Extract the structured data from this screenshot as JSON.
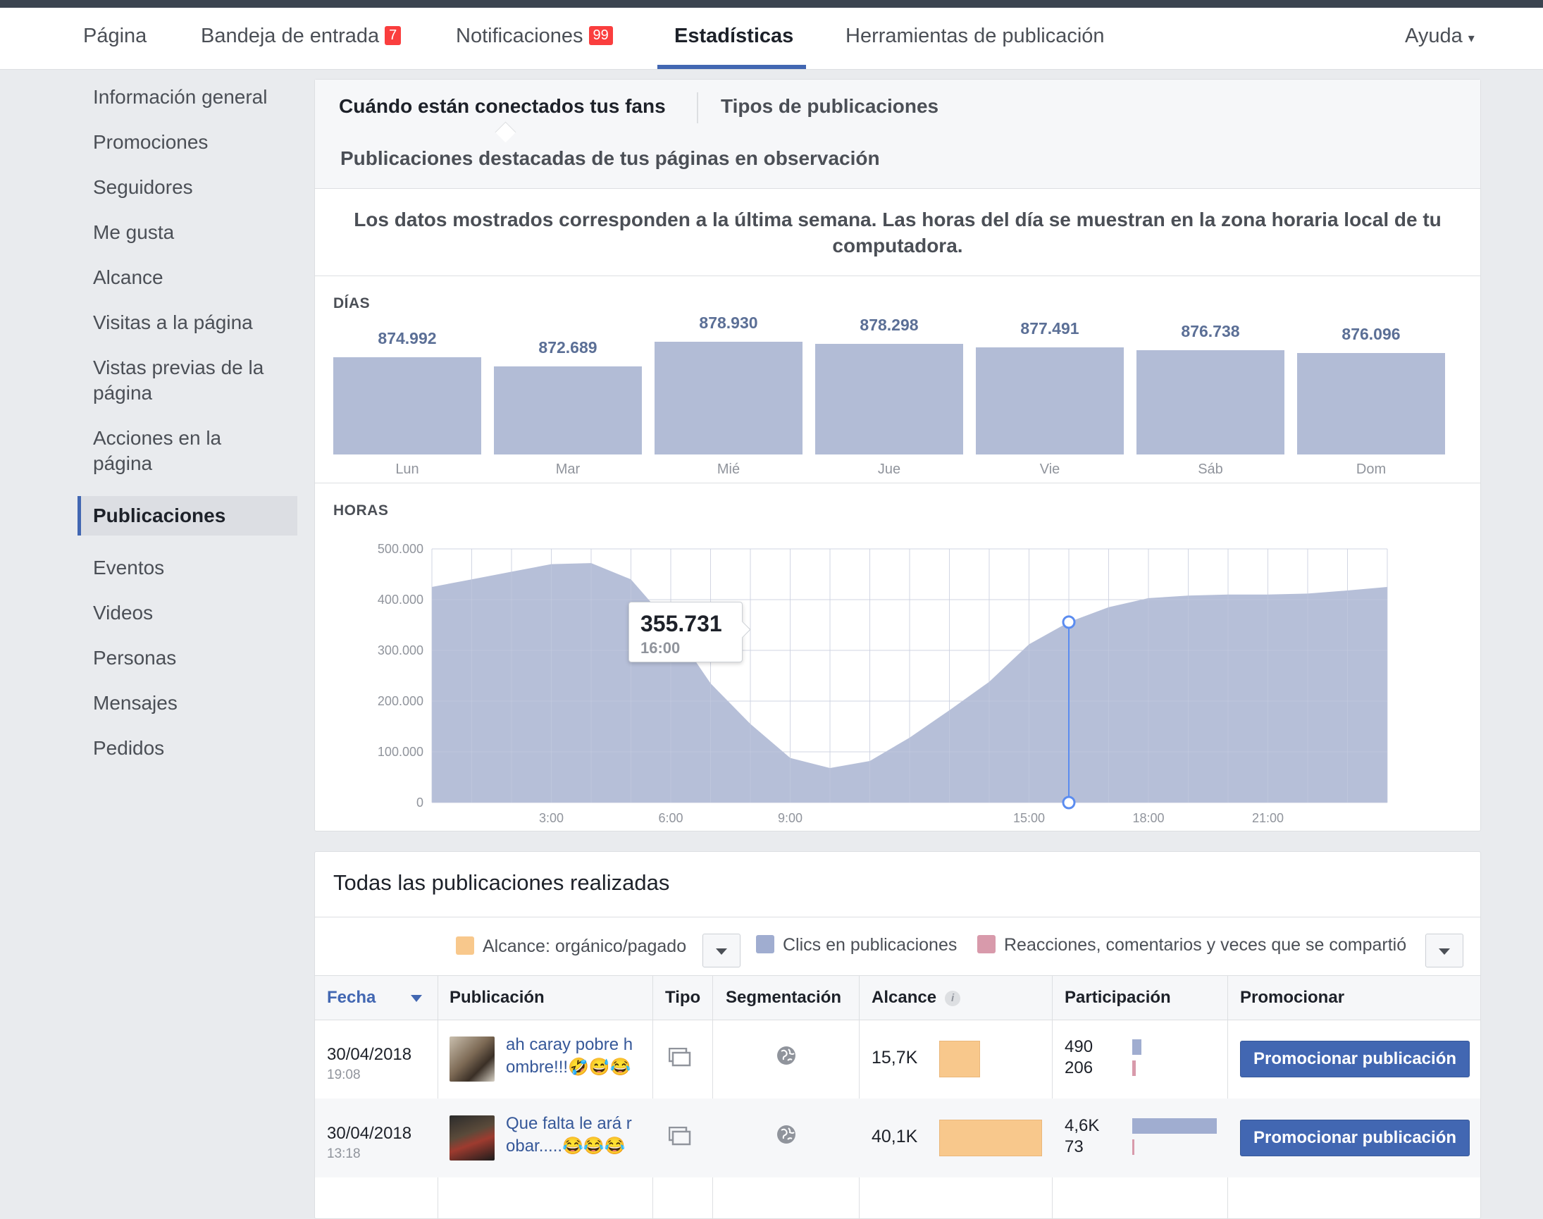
{
  "topnav": {
    "items": [
      {
        "label": "Página"
      },
      {
        "label": "Bandeja de entrada",
        "badge": "7"
      },
      {
        "label": "Notificaciones",
        "badge": "99"
      },
      {
        "label": "Estadísticas"
      },
      {
        "label": "Herramientas de publicación"
      }
    ],
    "help": "Ayuda",
    "active_color": "#4267b2",
    "badge_color": "#fa3e3e"
  },
  "sidebar": {
    "items": [
      {
        "label": "Información general"
      },
      {
        "label": "Promociones"
      },
      {
        "label": "Seguidores"
      },
      {
        "label": "Me gusta"
      },
      {
        "label": "Alcance"
      },
      {
        "label": "Visitas a la página"
      },
      {
        "label": "Vistas previas de la página"
      },
      {
        "label": "Acciones en la página"
      },
      {
        "label": "Publicaciones"
      },
      {
        "label": "Eventos"
      },
      {
        "label": "Videos"
      },
      {
        "label": "Personas"
      },
      {
        "label": "Mensajes"
      },
      {
        "label": "Pedidos"
      }
    ],
    "active": "Publicaciones"
  },
  "main": {
    "tabs": [
      {
        "label": "Cuándo están conectados tus fans"
      },
      {
        "label": "Tipos de publicaciones"
      },
      {
        "label": "Publicaciones destacadas de tus páginas en observación"
      }
    ],
    "info": "Los datos mostrados corresponden a la última semana. Las horas del día se muestran en la zona horaria local de tu computadora.",
    "days_label": "DÍAS",
    "hours_label": "HORAS",
    "tooltip": {
      "value": "355.731",
      "time": "16:00"
    }
  },
  "chart_data": [
    {
      "type": "bar",
      "title": "DÍAS",
      "categories": [
        "Lun",
        "Mar",
        "Mié",
        "Jue",
        "Vie",
        "Sáb",
        "Dom"
      ],
      "labels": [
        "874.992",
        "872.689",
        "878.930",
        "878.298",
        "877.491",
        "876.738",
        "876.096"
      ],
      "values": [
        874992,
        872689,
        878930,
        878298,
        877491,
        876738,
        876096
      ],
      "color": "#b2bcd6"
    },
    {
      "type": "area",
      "title": "HORAS",
      "x": [
        0,
        1,
        2,
        3,
        4,
        5,
        6,
        7,
        8,
        9,
        10,
        11,
        12,
        13,
        14,
        15,
        16,
        17,
        18,
        19,
        20,
        21,
        22,
        23,
        24
      ],
      "y": [
        425000,
        440000,
        455000,
        470000,
        472000,
        440000,
        350000,
        235000,
        155000,
        88000,
        68000,
        82000,
        128000,
        182000,
        238000,
        312000,
        355731,
        385000,
        403000,
        408000,
        410000,
        410000,
        412000,
        418000,
        425000
      ],
      "ylim": [
        0,
        500000
      ],
      "yticks": [
        "500.000",
        "400.000",
        "300.000",
        "200.000",
        "100.000",
        "0"
      ],
      "xticks": [
        "3:00",
        "6:00",
        "9:00",
        "15:00",
        "18:00",
        "21:00"
      ],
      "highlight": {
        "x": 16,
        "y": 355731
      },
      "color": "#b2bcd6",
      "grid": true
    }
  ],
  "posts": {
    "title": "Todas las publicaciones realizadas",
    "legend": [
      {
        "label": "Alcance: orgánico/pagado",
        "color": "#f8c88c"
      },
      {
        "label": "Clics en publicaciones",
        "color": "#a0add0"
      },
      {
        "label": "Reacciones, comentarios y veces que se compartió",
        "color": "#d89aab"
      }
    ],
    "columns": [
      "Fecha",
      "Publicación",
      "Tipo",
      "Segmentación",
      "Alcance",
      "Participación",
      "Promocionar"
    ],
    "rows": [
      {
        "date": "30/04/2018",
        "time": "19:08",
        "text": "ah caray pobre h ombre!!!🤣😅😂",
        "reach": "15,7K",
        "reach_value": 15.7,
        "clicks": "490",
        "reactions": "206",
        "clicks_value": 490,
        "reactions_value": 206,
        "promote": "Promocionar publicación"
      },
      {
        "date": "30/04/2018",
        "time": "13:18",
        "text": "Que falta le ará r obar.....😂😂😂",
        "reach": "40,1K",
        "reach_value": 40.1,
        "clicks": "4,6K",
        "reactions": "73",
        "clicks_value": 4600,
        "reactions_value": 73,
        "promote": "Promocionar publicación"
      }
    ]
  }
}
